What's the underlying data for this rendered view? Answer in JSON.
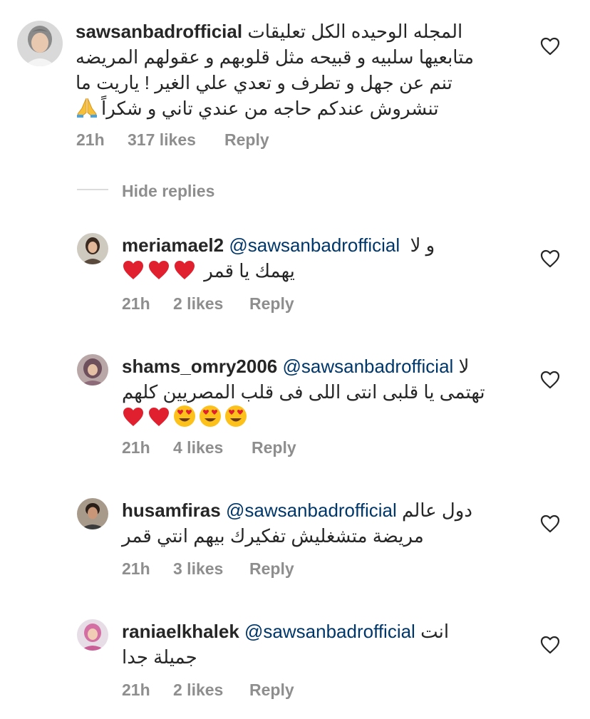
{
  "main_comment": {
    "username": "sawsanbadrofficial",
    "lines": [
      "المجله الوحيده الكل تعليقات",
      "متابعيها سلبيه و قبيحه مثل قلوبهم و عقولهم المريضه",
      "تنم عن جهل و تطرف و تعدي علي الغير ! ياريت ما",
      "تنشروش عندكم حاجه من عندي تاني و شكراً"
    ],
    "time": "21h",
    "likes": "317 likes",
    "reply_label": "Reply"
  },
  "hide_replies_label": "Hide replies",
  "replies": [
    {
      "username": "meriamael2",
      "mention": "@sawsanbadrofficial",
      "line1_tail": "و لا",
      "line2": "يهمك يا قمر",
      "time": "21h",
      "likes": "2 likes",
      "reply_label": "Reply"
    },
    {
      "username": "shams_omry2006",
      "mention": "@sawsanbadrofficial",
      "line1_tail": "لا",
      "line2": "تهتمى يا قلبى انتى اللى فى قلب المصريين كلهم",
      "time": "21h",
      "likes": "4 likes",
      "reply_label": "Reply"
    },
    {
      "username": "husamfiras",
      "mention": "@sawsanbadrofficial",
      "line1_tail": "دول عالم",
      "line2": "مريضة متشغليش تفكيرك بيهم انتي قمر",
      "time": "21h",
      "likes": "3 likes",
      "reply_label": "Reply"
    },
    {
      "username": "raniaelkhalek",
      "mention": "@sawsanbadrofficial",
      "line1_tail": "انت",
      "line2": "جميلة جدا",
      "time": "21h",
      "likes": "2 likes",
      "reply_label": "Reply"
    }
  ],
  "icons": {
    "like": "heart-outline-icon",
    "pray": "folded-hands-emoji",
    "red_heart": "red-heart-emoji",
    "heart_eyes": "heart-eyes-emoji"
  },
  "colors": {
    "text": "#262626",
    "secondary": "#8e8e8e",
    "mention": "#00376b",
    "divider": "#dbdbdb"
  }
}
